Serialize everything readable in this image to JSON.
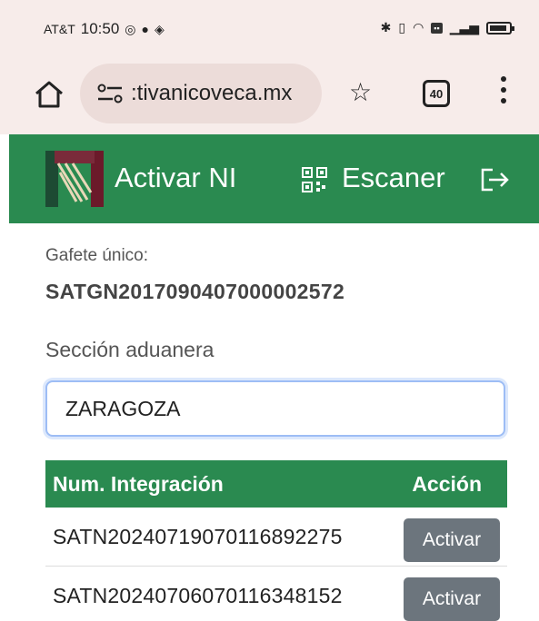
{
  "status_bar": {
    "carrier": "AT&T",
    "time": "10:50"
  },
  "browser": {
    "url": ":tivanicoveca.mx",
    "tab_count": "40"
  },
  "header": {
    "title": "Activar NI",
    "scan_label": "Escaner",
    "color": "#2a8a50"
  },
  "gafete": {
    "label": "Gafete único:",
    "value": "SATGN2017090407000002572"
  },
  "seccion": {
    "label": "Sección aduanera",
    "value": "ZARAGOZA"
  },
  "table": {
    "headers": [
      "Num. Integración",
      "Acción"
    ],
    "rows": [
      {
        "id": "SATN20240719070116892275",
        "action": "Activar"
      },
      {
        "id": "SATN20240706070116348152",
        "action": "Activar"
      }
    ]
  }
}
